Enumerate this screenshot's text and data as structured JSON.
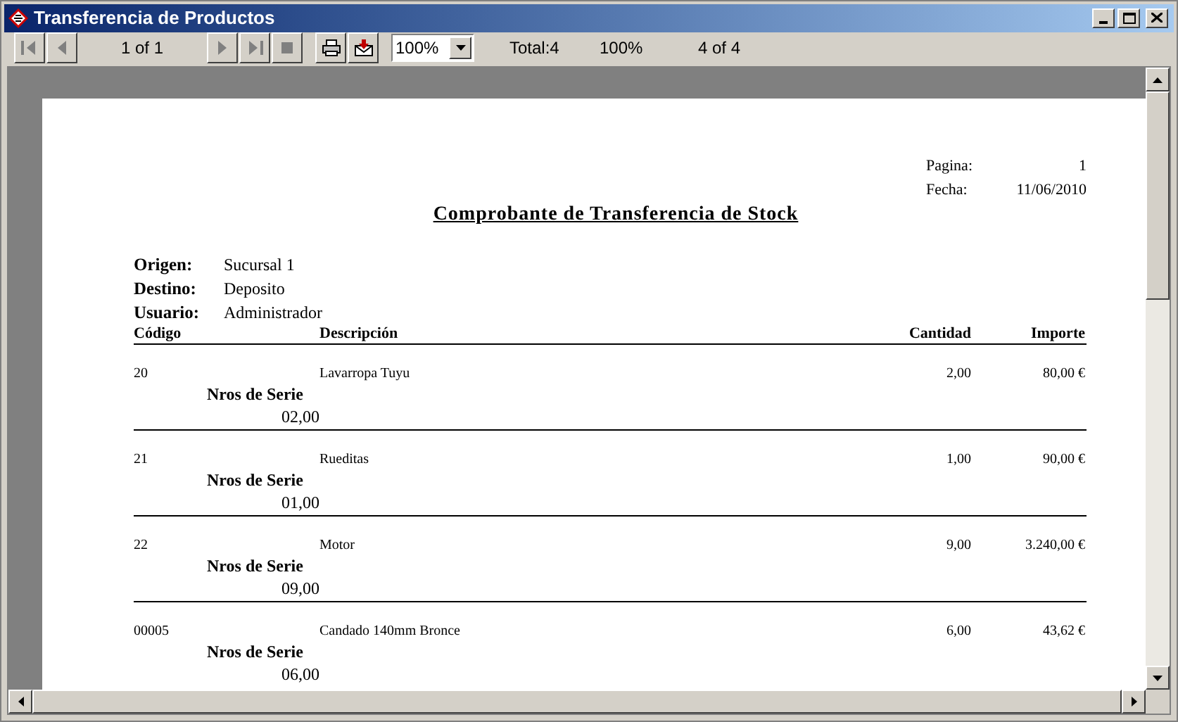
{
  "window": {
    "title": "Transferencia de Productos"
  },
  "toolbar": {
    "nav_left": [
      {
        "kind": "first",
        "disabled": true
      },
      {
        "kind": "prev",
        "disabled": true
      }
    ],
    "page_info": "1 of 1",
    "nav_right": [
      {
        "kind": "next",
        "disabled": true
      },
      {
        "kind": "last",
        "disabled": true
      },
      {
        "kind": "stop",
        "disabled": true
      }
    ],
    "actions": [
      {
        "kind": "print"
      },
      {
        "kind": "email"
      }
    ],
    "zoom": {
      "value": "100%"
    },
    "total": "Total:4",
    "percent": "100%",
    "records": "4 of 4"
  },
  "report": {
    "page_label": "Pagina:",
    "page_value": "1",
    "date_label": "Fecha:",
    "date_value": "11/06/2010",
    "title": "Comprobante de Transferencia de Stock",
    "header_fields": [
      {
        "label": "Origen:",
        "value": "Sucursal 1"
      },
      {
        "label": "Destino:",
        "value": "Deposito"
      },
      {
        "label": "Usuario:",
        "value": "Administrador"
      }
    ],
    "columns": [
      "Código",
      "Descripción",
      "Cantidad",
      "Importe"
    ],
    "rows": [
      {
        "code": "20",
        "description": "Lavarropa Tuyu",
        "quantity": "2,00",
        "amount": "80,00 €",
        "serial_label": "Nros de Serie",
        "serial": "02,00"
      },
      {
        "code": "21",
        "description": "Rueditas",
        "quantity": "1,00",
        "amount": "90,00 €",
        "serial_label": "Nros de Serie",
        "serial": "01,00"
      },
      {
        "code": "22",
        "description": "Motor",
        "quantity": "9,00",
        "amount": "3.240,00 €",
        "serial_label": "Nros de Serie",
        "serial": "09,00"
      },
      {
        "code": "00005",
        "description": "Candado 140mm Bronce",
        "quantity": "6,00",
        "amount": "43,62 €",
        "serial_label": "Nros de Serie",
        "serial": "06,00"
      }
    ]
  }
}
